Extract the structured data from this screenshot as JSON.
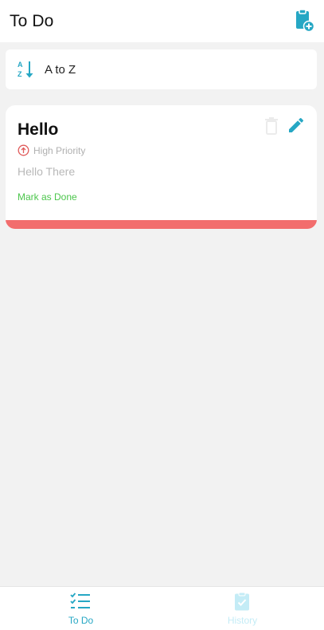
{
  "header": {
    "title": "To Do",
    "add_icon": "clipboard-add-icon"
  },
  "sort": {
    "label": "A to Z",
    "icon": "sort-alpha-icon"
  },
  "task_card": {
    "title": "Hello",
    "priority": "High Priority",
    "description": "Hello There",
    "action": "Mark as Done",
    "priority_color": "#f26d6d"
  },
  "bottom_nav": {
    "items": [
      {
        "label": "To Do",
        "icon": "checklist-icon",
        "active": true
      },
      {
        "label": "History",
        "icon": "clipboard-check-icon",
        "active": false
      }
    ]
  },
  "colors": {
    "accent": "#26a7c4",
    "done": "#4cc64c",
    "high_priority": "#f26d6d",
    "inactive_nav": "#c4ecf6"
  }
}
